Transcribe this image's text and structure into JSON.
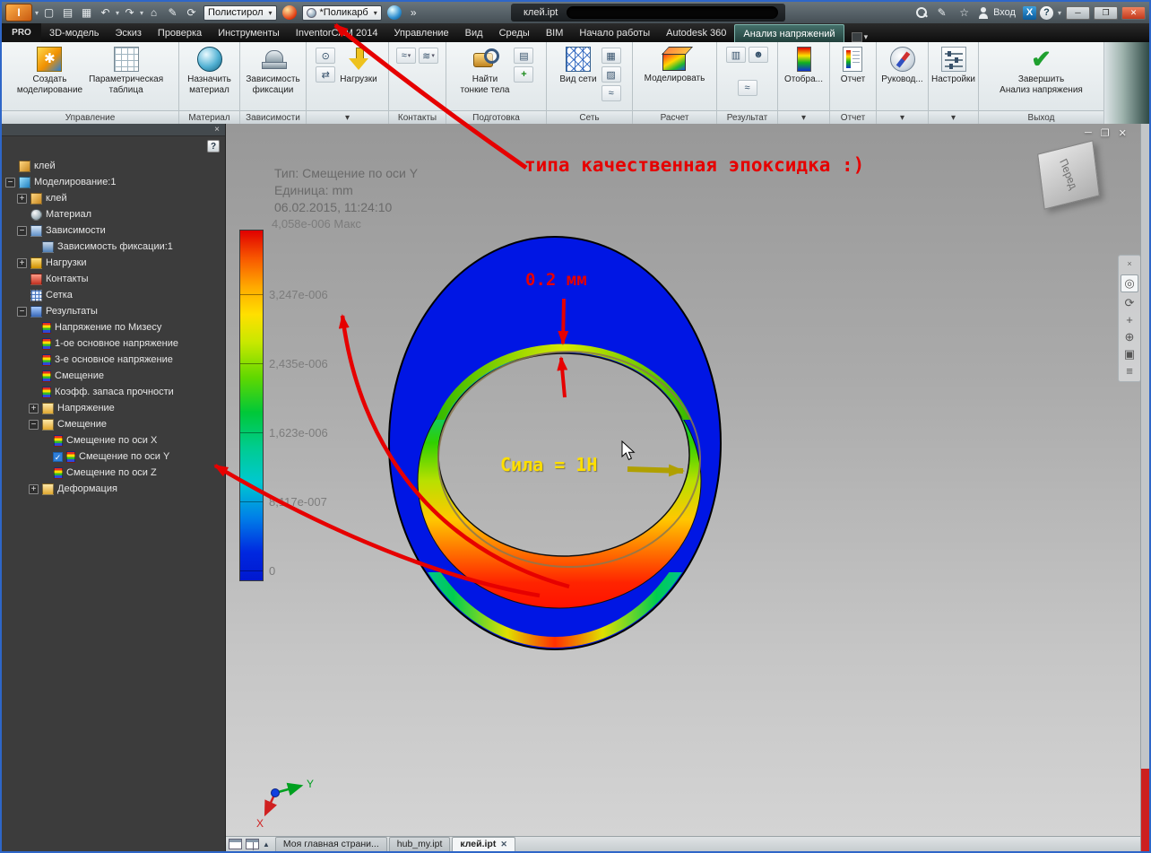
{
  "titlebar": {
    "app_label": "PRO",
    "material_combo": "Полистирол",
    "appearance_combo": "*Поликарб",
    "doc_name": "клей.ipt",
    "sign_in": "Вход"
  },
  "icons": {
    "dropdown": "▾",
    "overflow": "»",
    "undo": "↶",
    "redo": "↷",
    "home": "⌂",
    "pencil": "✎",
    "refresh": "⟳",
    "star": "☆",
    "help": "?",
    "minimize": "─",
    "maximize": "❐",
    "close": "✕",
    "tab_close": "✕",
    "browser_close": "×",
    "check": "✔"
  },
  "ribbon": {
    "tabs": [
      "3D-модель",
      "Эскиз",
      "Проверка",
      "Инструменты",
      "InventorCAM 2014",
      "Управление",
      "Вид",
      "Среды",
      "BIM",
      "Начало работы",
      "Autodesk 360",
      "Анализ напряжений"
    ],
    "active_tab": "Анализ напряжений",
    "panels": [
      {
        "label": "Управление",
        "buttons": [
          {
            "l1": "Создать",
            "l2": "моделирование"
          },
          {
            "l1": "Параметрическая",
            "l2": "таблица"
          }
        ]
      },
      {
        "label": "Материал",
        "buttons": [
          {
            "l1": "Назначить",
            "l2": "материал"
          }
        ]
      },
      {
        "label": "Зависимости",
        "buttons": [
          {
            "l1": "Зависимость",
            "l2": "фиксации"
          }
        ]
      },
      {
        "label": "▾",
        "buttons": [
          {
            "l1": "Нагрузки",
            "l2": ""
          }
        ]
      },
      {
        "label": "Контакты",
        "buttons": []
      },
      {
        "label": "Подготовка",
        "buttons": [
          {
            "l1": "Найти",
            "l2": "тонкие тела"
          }
        ]
      },
      {
        "label": "Сеть",
        "buttons": [
          {
            "l1": "Вид сети",
            "l2": ""
          }
        ]
      },
      {
        "label": "Расчет",
        "buttons": [
          {
            "l1": "Моделировать",
            "l2": ""
          }
        ]
      },
      {
        "label": "Результат",
        "buttons": []
      },
      {
        "label": "▾",
        "buttons": [
          {
            "l1": "Отобра...",
            "l2": ""
          }
        ]
      },
      {
        "label": "Отчет",
        "buttons": [
          {
            "l1": "Отчет",
            "l2": ""
          }
        ]
      },
      {
        "label": "▾",
        "buttons": [
          {
            "l1": "Руковод...",
            "l2": ""
          }
        ]
      },
      {
        "label": "▾",
        "buttons": [
          {
            "l1": "Настройки",
            "l2": ""
          }
        ]
      },
      {
        "label": "Выход",
        "buttons": [
          {
            "l1": "Завершить",
            "l2": "Анализ напряжения"
          }
        ]
      }
    ]
  },
  "browser": {
    "items": [
      {
        "label": "клей",
        "level": 0,
        "expand": "",
        "icon": "part"
      },
      {
        "label": "Моделирование:1",
        "level": 0,
        "expand": "-",
        "icon": "simulation"
      },
      {
        "label": "клей",
        "level": 1,
        "expand": "+",
        "icon": "part"
      },
      {
        "label": "Материал",
        "level": 1,
        "expand": "",
        "icon": "material"
      },
      {
        "label": "Зависимости",
        "level": 1,
        "expand": "-",
        "icon": "constraints"
      },
      {
        "label": "Зависимость фиксации:1",
        "level": 2,
        "expand": "",
        "icon": "fix"
      },
      {
        "label": "Нагрузки",
        "level": 1,
        "expand": "+",
        "icon": "loads"
      },
      {
        "label": "Контакты",
        "level": 1,
        "expand": "",
        "icon": "contacts"
      },
      {
        "label": "Сетка",
        "level": 1,
        "expand": "",
        "icon": "mesh"
      },
      {
        "label": "Результаты",
        "level": 1,
        "expand": "-",
        "icon": "results"
      },
      {
        "label": "Напряжение по Мизесу",
        "level": 2,
        "expand": "",
        "icon": "result"
      },
      {
        "label": "1-ое основное напряжение",
        "level": 2,
        "expand": "",
        "icon": "result"
      },
      {
        "label": "3-е основное напряжение",
        "level": 2,
        "expand": "",
        "icon": "result"
      },
      {
        "label": "Смещение",
        "level": 2,
        "expand": "",
        "icon": "result"
      },
      {
        "label": "Коэфф. запаса прочности",
        "level": 2,
        "expand": "",
        "icon": "result"
      },
      {
        "label": "Напряжение",
        "level": 2,
        "expand": "+",
        "icon": "folder"
      },
      {
        "label": "Смещение",
        "level": 2,
        "expand": "-",
        "icon": "folder"
      },
      {
        "label": "Смещение по оси X",
        "level": 3,
        "expand": "",
        "icon": "result"
      },
      {
        "label": "Смещение по оси Y",
        "level": 3,
        "expand": "",
        "icon": "result",
        "checked": true
      },
      {
        "label": "Смещение по оси Z",
        "level": 3,
        "expand": "",
        "icon": "result"
      },
      {
        "label": "Деформация",
        "level": 2,
        "expand": "+",
        "icon": "folder"
      }
    ]
  },
  "viewport": {
    "header": {
      "type": "Тип: Смещение по оси Y",
      "unit": "Единица: mm",
      "timestamp": "06.02.2015, 11:24:10"
    },
    "legend": {
      "max": "4,058e-006 Макс",
      "ticks": [
        "3,247e-006",
        "2,435e-006",
        "1,623e-006",
        "8,117e-007",
        "0"
      ]
    },
    "annotations": {
      "note": "типа качественная эпоксидка :)",
      "gap": "0.2 мм",
      "force": "Сила = 1Н"
    },
    "viewcube": "Перед",
    "triad": {
      "x": "X",
      "y": "Y"
    }
  },
  "doc_tabs": [
    "Моя главная страни...",
    "hub_my.ipt",
    "клей.ipt"
  ],
  "active_doc_tab": "клей.ipt"
}
